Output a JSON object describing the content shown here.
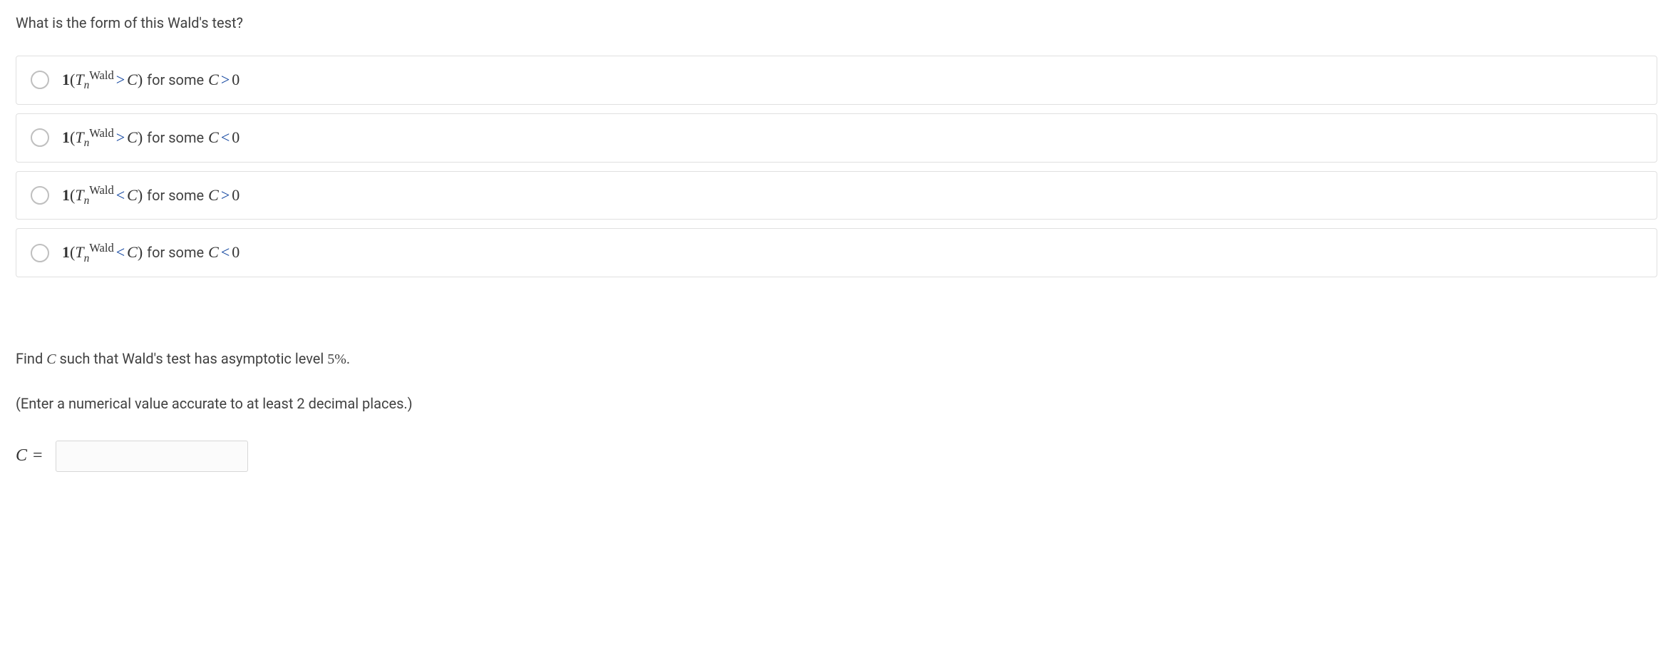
{
  "question": "What is the form of this Wald's test?",
  "options": [
    {
      "one": "1",
      "open": " (",
      "T": "T",
      "sub_n": "n",
      "sup_wald": "Wald",
      "op": ">",
      "C1": "C",
      "close": ")",
      "for_some": " for some ",
      "C2": "C",
      "rel": ">",
      "zero": "0"
    },
    {
      "one": "1",
      "open": " (",
      "T": "T",
      "sub_n": "n",
      "sup_wald": "Wald",
      "op": ">",
      "C1": "C",
      "close": ")",
      "for_some": " for some ",
      "C2": "C",
      "rel": "<",
      "zero": "0"
    },
    {
      "one": "1",
      "open": " (",
      "T": "T",
      "sub_n": "n",
      "sup_wald": "Wald",
      "op": "<",
      "C1": "C",
      "close": ")",
      "for_some": " for some ",
      "C2": "C",
      "rel": ">",
      "zero": "0"
    },
    {
      "one": "1",
      "open": " (",
      "T": "T",
      "sub_n": "n",
      "sup_wald": "Wald",
      "op": "<",
      "C1": "C",
      "close": ")",
      "for_some": " for some ",
      "C2": "C",
      "rel": "<",
      "zero": "0"
    }
  ],
  "follow": {
    "pre": "Find ",
    "C": "C",
    "post": " such that Wald's test has asymptotic level ",
    "pct_num": "5%",
    "dot": "."
  },
  "hint": "(Enter a numerical value accurate to at least 2 decimal places.)",
  "answer": {
    "C": "C",
    "eq": "=",
    "value": ""
  }
}
